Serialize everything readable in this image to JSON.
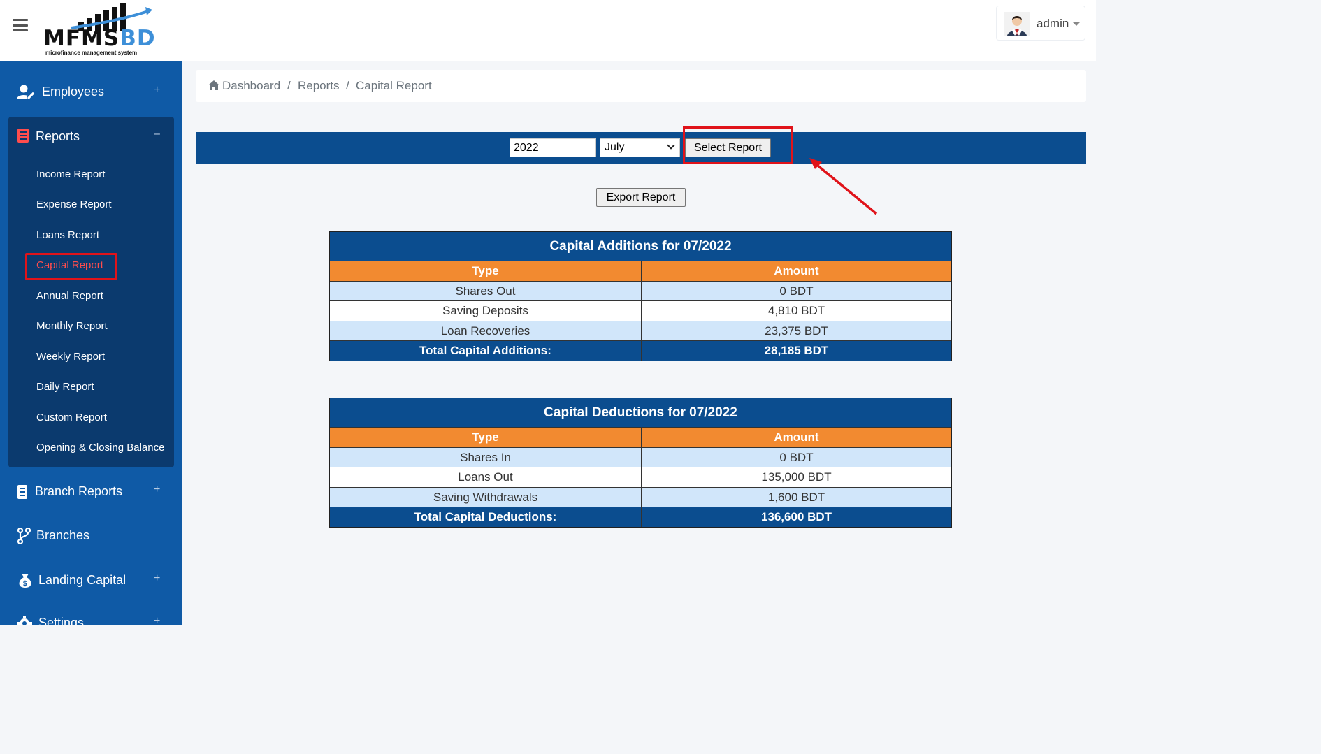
{
  "app": {
    "logo_text": "MFMS",
    "logo_text_accent": "BD",
    "logo_subtitle": "microfinance management system"
  },
  "user": {
    "name": "admin"
  },
  "sidebar": {
    "employees": {
      "label": "Employees",
      "toggle": "+"
    },
    "reports": {
      "label": "Reports",
      "toggle": "–",
      "items": [
        {
          "label": "Income Report"
        },
        {
          "label": "Expense Report"
        },
        {
          "label": "Loans Report"
        },
        {
          "label": "Capital Report"
        },
        {
          "label": "Annual Report"
        },
        {
          "label": "Monthly Report"
        },
        {
          "label": "Weekly Report"
        },
        {
          "label": "Daily Report"
        },
        {
          "label": "Custom Report"
        },
        {
          "label": "Opening & Closing Balance"
        }
      ]
    },
    "branch_reports": {
      "label": "Branch Reports",
      "toggle": "+"
    },
    "branches": {
      "label": "Branches"
    },
    "landing_capital": {
      "label": "Landing Capital",
      "toggle": "+"
    },
    "settings": {
      "label": "Settings",
      "toggle": "+"
    }
  },
  "breadcrumb": {
    "home": "Dashboard",
    "sep": "/",
    "reports": "Reports",
    "current": "Capital Report"
  },
  "filter": {
    "year": "2022",
    "month": "July",
    "select_label": "Select Report"
  },
  "export_label": "Export Report",
  "additions": {
    "title": "Capital Additions for 07/2022",
    "head": {
      "type": "Type",
      "amount": "Amount"
    },
    "rows": [
      {
        "type": "Shares Out",
        "amount": "0 BDT"
      },
      {
        "type": "Saving Deposits",
        "amount": "4,810 BDT"
      },
      {
        "type": "Loan Recoveries",
        "amount": "23,375 BDT"
      }
    ],
    "total": {
      "label": "Total Capital Additions:",
      "amount": "28,185 BDT"
    }
  },
  "deductions": {
    "title": "Capital Deductions for 07/2022",
    "head": {
      "type": "Type",
      "amount": "Amount"
    },
    "rows": [
      {
        "type": "Shares In",
        "amount": "0 BDT"
      },
      {
        "type": "Loans Out",
        "amount": "135,000 BDT"
      },
      {
        "type": "Saving Withdrawals",
        "amount": "1,600 BDT"
      }
    ],
    "total": {
      "label": "Total Capital Deductions:",
      "amount": "136,600 BDT"
    }
  },
  "colors": {
    "sidebar": "#0f5aa6",
    "sidebar_group": "#0b3a6e",
    "table_header": "#0b4d8f",
    "column_header": "#f28a30",
    "row_light": "#d1e6fa",
    "highlight": "#e0131a"
  }
}
